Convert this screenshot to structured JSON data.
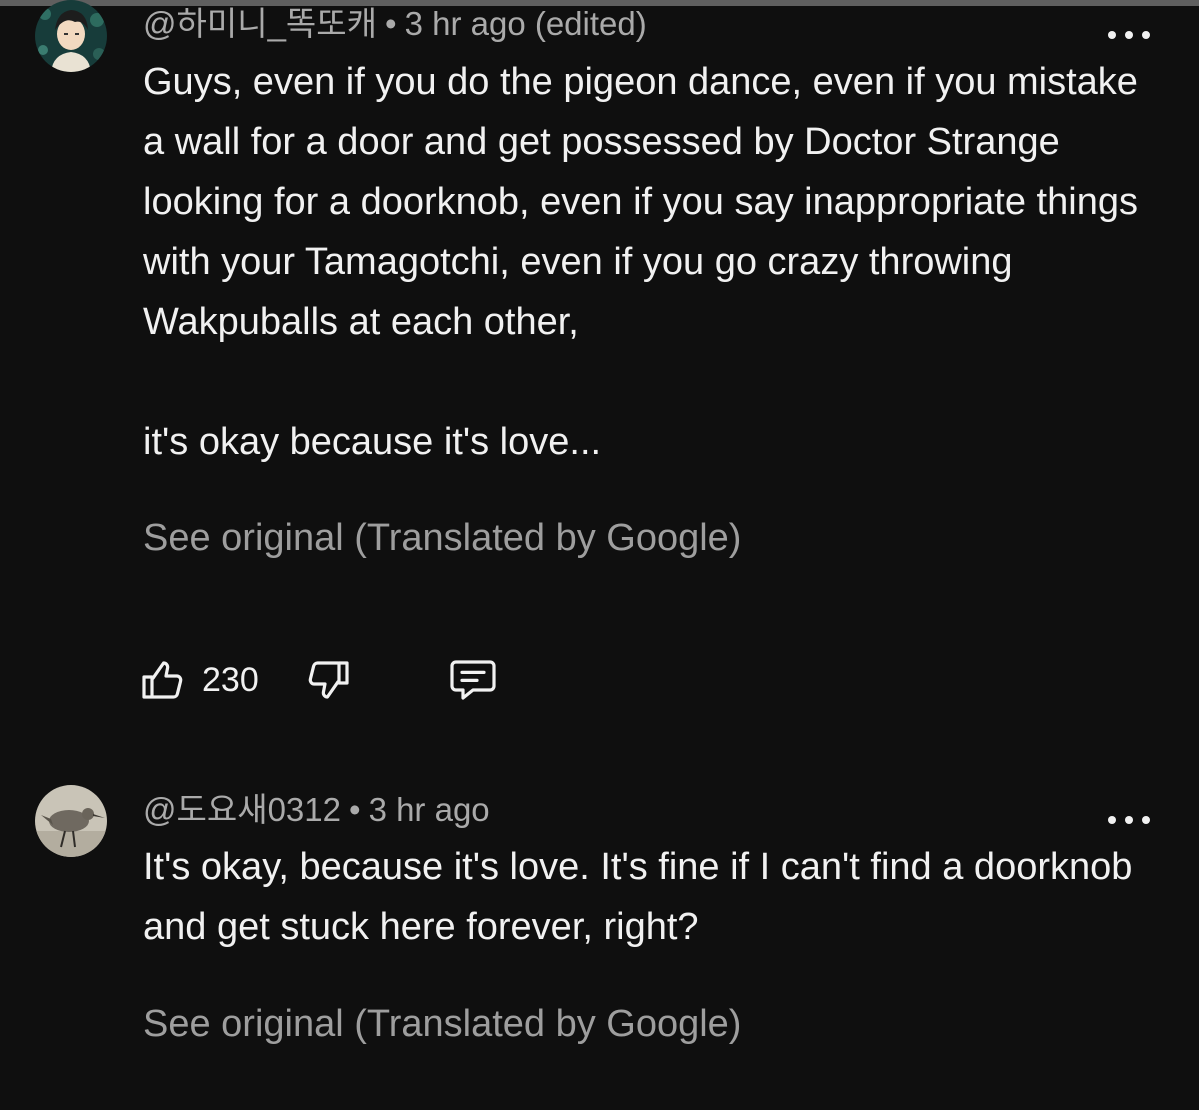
{
  "comments": [
    {
      "handle": "@하미니_똑또캐",
      "separator": "•",
      "time": "3 hr ago (edited)",
      "text": "Guys, even if you do the pigeon dance, even if you mistake a wall for a door and get possessed by Doctor Strange looking for a doorknob, even if you say inappropriate things with your Tamagotchi, even if you go crazy throwing Wakpuballs at each other,\n\nit's okay because it's love...",
      "translate_label": "See original (Translated by Google)",
      "like_count": "230",
      "avatar_icon": "anime-character-avatar"
    },
    {
      "handle": "@도요새0312",
      "separator": "•",
      "time": "3 hr ago",
      "text": "It's okay, because it's love. It's fine if I can't find a doorknob and get stuck here forever, right?",
      "translate_label": "See original (Translated by Google)",
      "avatar_icon": "sandpiper-bird-avatar"
    }
  ],
  "icons": {
    "more": "more-vert-icon",
    "like": "thumbs-up-icon",
    "dislike": "thumbs-down-icon",
    "reply": "reply-comment-icon"
  },
  "colors": {
    "background": "#0f0f0f",
    "text": "#f1f1f1",
    "meta": "#aaaaaa",
    "translate": "#9e9e9e"
  }
}
